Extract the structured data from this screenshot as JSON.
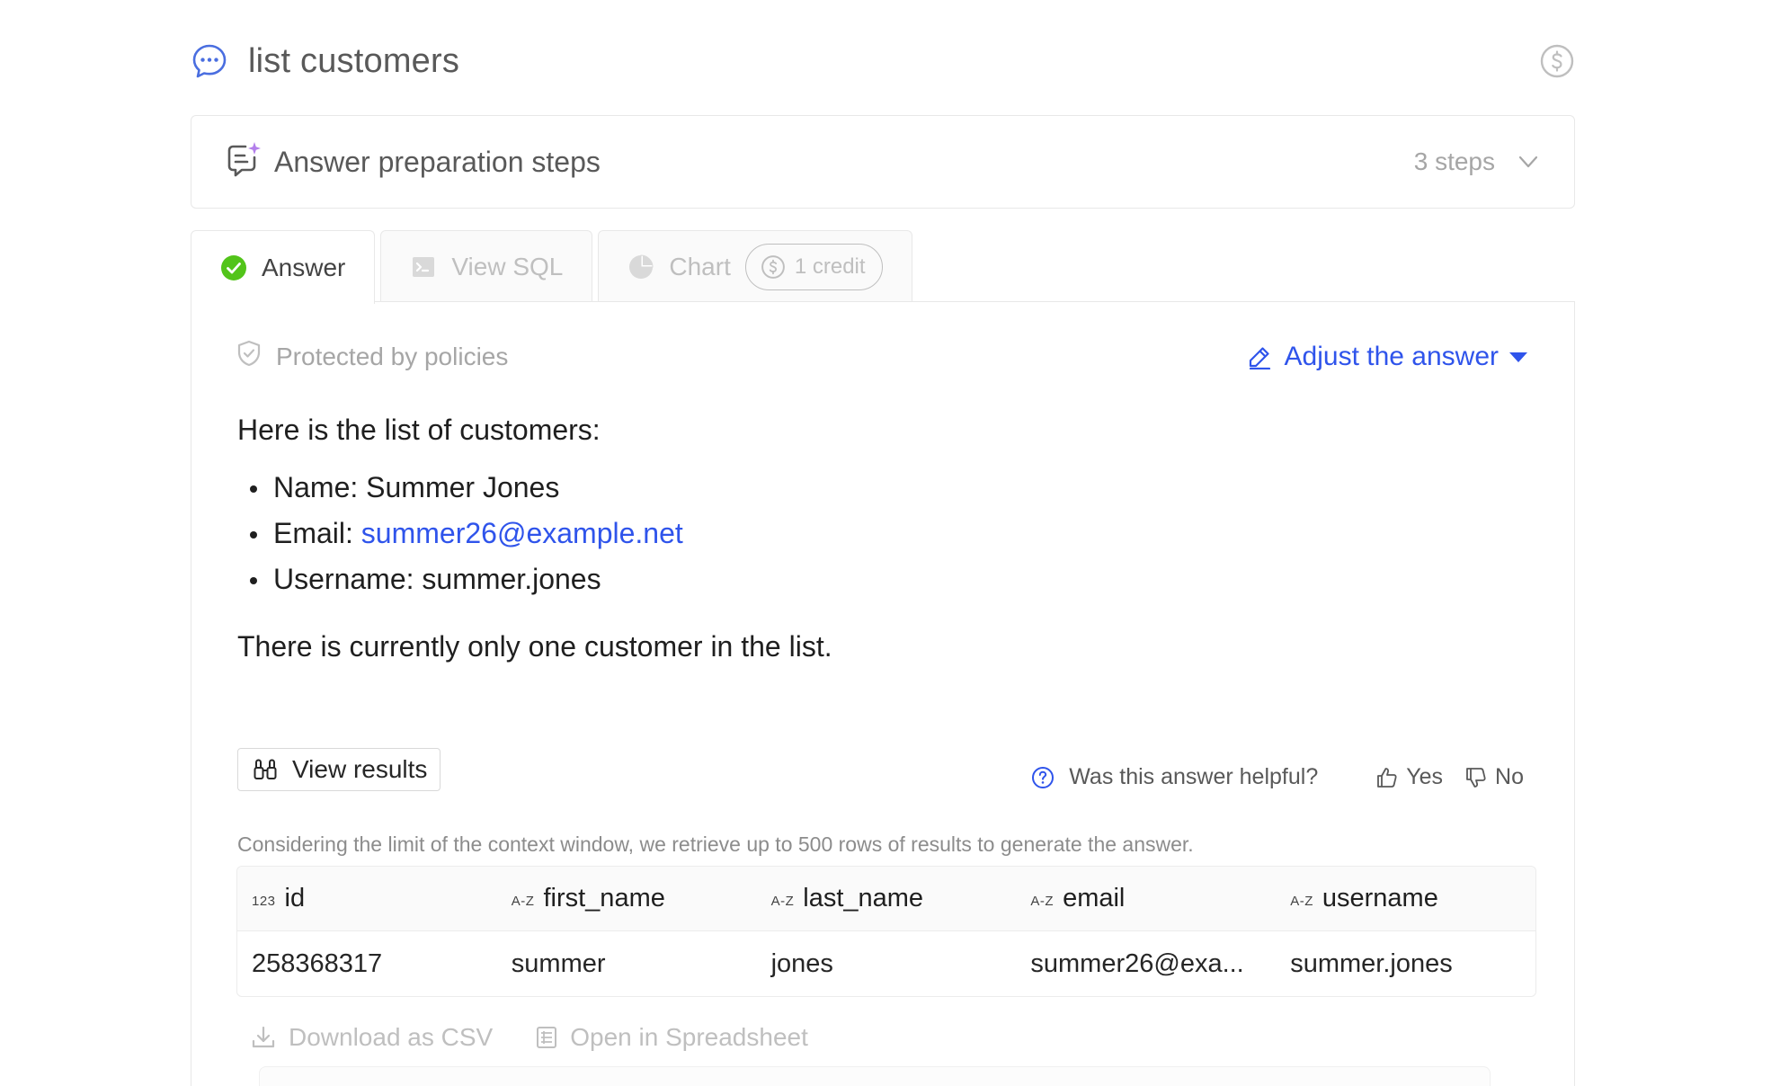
{
  "header": {
    "title": "list customers",
    "chat_icon": "chat-bubble-icon",
    "credit_icon": "dollar-circle-icon"
  },
  "steps": {
    "title": "Answer preparation steps",
    "count": "3 steps",
    "icon": "sparkle-message-icon"
  },
  "tabs": [
    {
      "label": "Answer",
      "icon": "check-circle-icon",
      "active": true
    },
    {
      "label": "View SQL",
      "icon": "terminal-icon",
      "active": false
    },
    {
      "label": "Chart",
      "icon": "pie-chart-icon",
      "active": false,
      "credit": "1 credit"
    }
  ],
  "answer": {
    "policy": "Protected by policies",
    "adjust_label": "Adjust the answer",
    "intro": "Here is the list of customers:",
    "items": {
      "name_label": "Name:",
      "name_value": "Summer Jones",
      "email_label": "Email:",
      "email_value": "summer26@example.net",
      "username_label": "Username:",
      "username_value": "summer.jones"
    },
    "conclusion": "There is currently only one customer in the list."
  },
  "results": {
    "view_results_label": "View results",
    "helpful_question": "Was this answer helpful?",
    "yes_label": "Yes",
    "no_label": "No",
    "context_note": "Considering the limit of the context window, we retrieve up to 500 rows of results to generate the answer.",
    "columns": [
      {
        "type": "123",
        "name": "id"
      },
      {
        "type": "A-Z",
        "name": "first_name"
      },
      {
        "type": "A-Z",
        "name": "last_name"
      },
      {
        "type": "A-Z",
        "name": "email"
      },
      {
        "type": "A-Z",
        "name": "username"
      }
    ],
    "rows": [
      [
        "258368317",
        "summer",
        "jones",
        "summer26@exa...",
        "summer.jones"
      ]
    ],
    "download_label": "Download as CSV",
    "spreadsheet_label": "Open in Spreadsheet"
  },
  "colors": {
    "accent": "#2f54eb",
    "success": "#52c41a",
    "sparkle": "#b37feb"
  }
}
